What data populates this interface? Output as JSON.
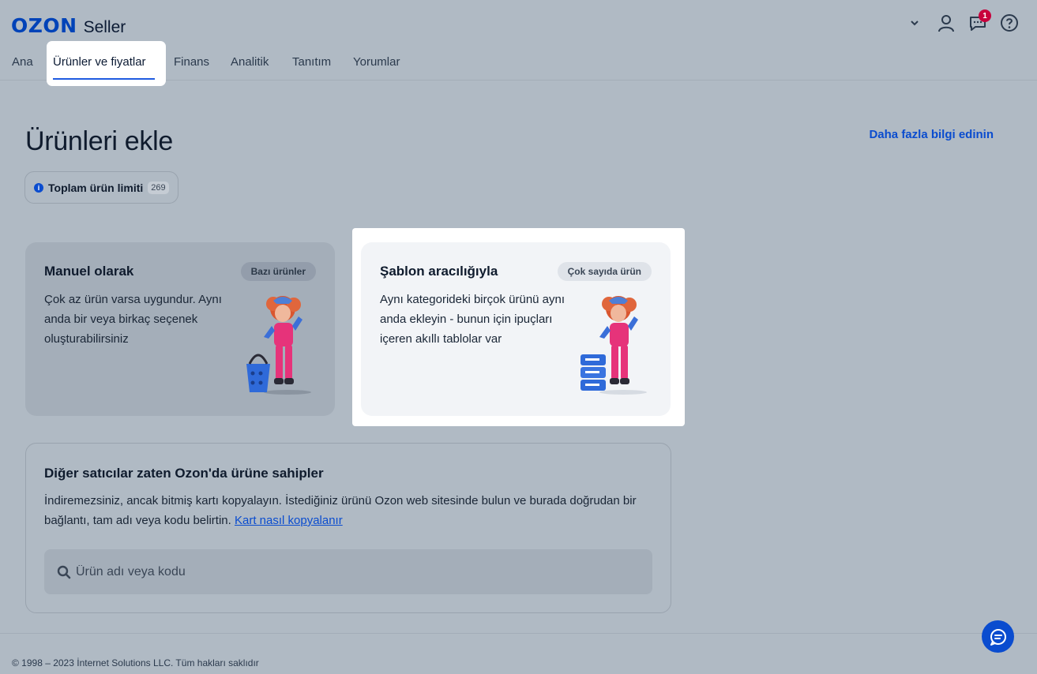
{
  "brand": {
    "logo": "OZON",
    "product": "Seller"
  },
  "nav": {
    "items": [
      "Ana",
      "Ürünler ve fiyatlar",
      "Finans",
      "Analitik",
      "Tanıtım",
      "Yorumlar"
    ],
    "active_index": 1
  },
  "header_icons": {
    "chevron": "chevron-down-icon",
    "user": "user-icon",
    "chat": "chat-icon",
    "help": "help-icon",
    "chat_badge": "1"
  },
  "page": {
    "title": "Ürünleri ekle",
    "more_info": "Daha fazla bilgi edinin",
    "limit_label": "Toplam ürün limiti",
    "limit_count": "269"
  },
  "cards": {
    "manual": {
      "title": "Manuel olarak",
      "tag": "Bazı ürünler",
      "description": "Çok az ürün varsa uygundur. Aynı anda bir veya birkaç seçenek oluşturabilirsiniz"
    },
    "template": {
      "title": "Şablon aracılığıyla",
      "tag": "Çok sayıda ürün",
      "description": "Aynı kategorideki birçok ürünü aynı anda ekleyin - bunun için ipuçları içeren akıllı tablolar var"
    }
  },
  "copy": {
    "title": "Diğer satıcılar zaten Ozon'da ürüne sahipler",
    "description": "İndiremezsiniz, ancak bitmiş kartı kopyalayın. İstediğiniz ürünü Ozon web sitesinde bulun ve burada doğrudan bir bağlantı, tam adı veya kodu belirtin.",
    "link": "Kart nasıl kopyalanır",
    "search_placeholder": "Ürün adı veya kodu",
    "search_value": ""
  },
  "footer": {
    "copyright": "© 1998 – 2023 İnternet Solutions LLC. Tüm hakları saklıdır"
  },
  "colors": {
    "accent": "#0a4ccf",
    "brand": "#0043b8",
    "badge": "#c8003c",
    "background": "#b0bac4"
  }
}
